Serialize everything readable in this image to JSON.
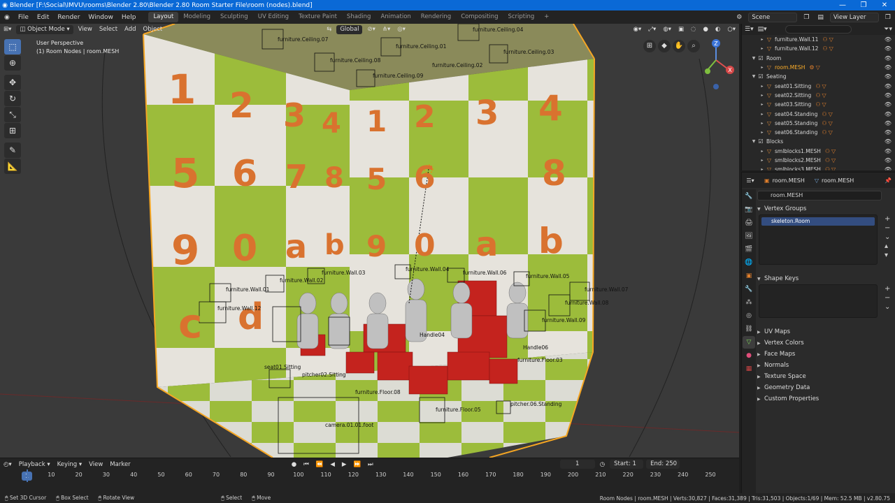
{
  "window": {
    "title": "Blender [F:\\Social\\IMVU\\rooms\\Blender 2.80\\Blender 2.80 Room Starter File\\room (nodes).blend]",
    "controls": [
      "—",
      "❐",
      "✕"
    ]
  },
  "menu": [
    "File",
    "Edit",
    "Render",
    "Window",
    "Help"
  ],
  "workspaces": [
    "Layout",
    "Modeling",
    "Sculpting",
    "UV Editing",
    "Texture Paint",
    "Shading",
    "Animation",
    "Rendering",
    "Compositing",
    "Scripting"
  ],
  "active_workspace": "Layout",
  "scene": {
    "label": "Scene",
    "view_layer": "View Layer"
  },
  "viewport": {
    "mode": "Object Mode",
    "menus": [
      "View",
      "Select",
      "Add",
      "Object"
    ],
    "orientation": "Global",
    "info_line1": "User Perspective",
    "info_line2": "(1) Room Nodes | room.MESH",
    "tile_numbers_row1": [
      "1",
      "2",
      "3",
      "4",
      "1",
      "2",
      "3",
      "4"
    ],
    "tile_numbers_row2": [
      "5",
      "6",
      "7",
      "8",
      "5",
      "6",
      "8"
    ],
    "tile_letters_row3": [
      "9",
      "0",
      "a",
      "b",
      "9",
      "0",
      "a",
      "b"
    ],
    "tile_letters_row4": [
      "c",
      "d"
    ]
  },
  "scene_labels": [
    "furniture.Ceiling.07",
    "furniture.Ceiling.01",
    "furniture.Ceiling.04",
    "furniture.Ceiling.08",
    "furniture.Ceiling.02",
    "furniture.Ceiling.03",
    "furniture.Ceiling.09",
    "furniture.Wall.01",
    "furniture.Wall.02",
    "furniture.Wall.03",
    "furniture.Wall.04",
    "furniture.Wall.06",
    "furniture.Wall.05",
    "furniture.Wall.07",
    "furniture.Wall.08",
    "furniture.Wall.09",
    "furniture.Wall.12",
    "furniture.Floor.05",
    "furniture.Floor.08",
    "furniture.Floor.03",
    "camera.01.01.foot",
    "Handle04",
    "Handle06",
    "seat01.Sitting",
    "pitcher02.Sitting",
    "pitcher.06.Standing"
  ],
  "timeline": {
    "menus": [
      "Playback",
      "Keying",
      "View",
      "Marker"
    ],
    "current_frame": "1",
    "start_label": "Start:",
    "start": "1",
    "end_label": "End:",
    "end": "250",
    "ticks": [
      "1",
      "10",
      "20",
      "30",
      "40",
      "50",
      "60",
      "70",
      "80",
      "90",
      "100",
      "110",
      "120",
      "130",
      "140",
      "150",
      "160",
      "170",
      "180",
      "190",
      "200",
      "210",
      "220",
      "230",
      "240",
      "250"
    ]
  },
  "statusbar": {
    "left": [
      "Set 3D Cursor",
      "Box Select",
      "Rotate View",
      "Select",
      "Move"
    ],
    "right": "Room Nodes | room.MESH | Verts:30,827 | Faces:31,389 | Tris:31,503 | Objects:1/69 | Mem: 52.5 MB | v2.80.75"
  },
  "outliner": {
    "rows": [
      {
        "label": "furniture.Wall.11",
        "type": "obj",
        "indent": 2
      },
      {
        "label": "furniture.Wall.12",
        "type": "obj",
        "indent": 2
      },
      {
        "label": "Room",
        "type": "coll",
        "indent": 1
      },
      {
        "label": "room.MESH",
        "type": "mesh",
        "indent": 2,
        "selected": true
      },
      {
        "label": "Seating",
        "type": "coll",
        "indent": 1
      },
      {
        "label": "seat01.Sitting",
        "type": "obj",
        "indent": 2
      },
      {
        "label": "seat02.Sitting",
        "type": "obj",
        "indent": 2
      },
      {
        "label": "seat03.Sitting",
        "type": "obj",
        "indent": 2
      },
      {
        "label": "seat04.Standing",
        "type": "obj",
        "indent": 2
      },
      {
        "label": "seat05.Standing",
        "type": "obj",
        "indent": 2
      },
      {
        "label": "seat06.Standing",
        "type": "obj",
        "indent": 2
      },
      {
        "label": "Blocks",
        "type": "coll",
        "indent": 1
      },
      {
        "label": "smlblocks1.MESH",
        "type": "obj",
        "indent": 2
      },
      {
        "label": "smlblocks2.MESH",
        "type": "obj",
        "indent": 2
      },
      {
        "label": "smlblocks3.MESH",
        "type": "obj",
        "indent": 2
      }
    ]
  },
  "properties": {
    "object_name": "room.MESH",
    "data_name": "room.MESH",
    "mesh_field": "room.MESH",
    "vertex_groups_title": "Vertex Groups",
    "vertex_group_item": "skeleton.Room",
    "shape_keys_title": "Shape Keys",
    "collapsed_panels": [
      "UV Maps",
      "Vertex Colors",
      "Face Maps",
      "Normals",
      "Texture Space",
      "Geometry Data",
      "Custom Properties"
    ]
  }
}
